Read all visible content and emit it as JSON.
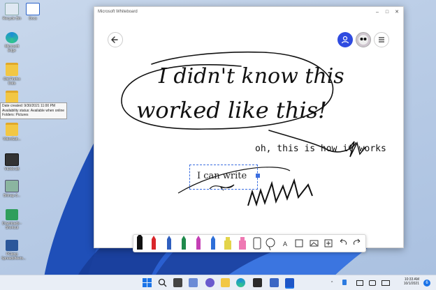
{
  "desktop": {
    "icons": [
      {
        "label": "Recycle Bin",
        "icon": "recycle-bin-icon"
      },
      {
        "label": "Docs",
        "icon": "document-icon"
      },
      {
        "label": "Microsoft Edge",
        "icon": "edge-icon"
      },
      {
        "label": "Old Firefox Data",
        "icon": "folder-icon"
      },
      {
        "label": "",
        "icon": "folder-icon"
      },
      {
        "label": "VideoSub...",
        "icon": "folder-icon"
      },
      {
        "label": "VID00.3B",
        "icon": "video-file-icon"
      },
      {
        "label": "Bitmap-3...",
        "icon": "image-file-icon"
      },
      {
        "label": "Downloads - Shortcut",
        "icon": "downloads-shortcut-icon"
      },
      {
        "label": "PCking Spreadsheets...",
        "icon": "word-file-icon"
      }
    ],
    "tooltip": {
      "line1": "Date created: 9/30/2021 11:00 PM",
      "line2": "Availability status: Available when online",
      "line3": "Folders: Pictures"
    }
  },
  "window": {
    "title": "Microsoft Whiteboard",
    "controls": {
      "minimize": "–",
      "maximize": "□",
      "close": "✕"
    }
  },
  "canvas": {
    "handwriting_1": "I didn't know this",
    "handwriting_2": "worked like this!",
    "typed_note": "oh, this is how it works",
    "text_box": "I can write"
  },
  "toolbar": {
    "pen_colors": [
      "#111111",
      "#d9262b",
      "#2f5fbf",
      "#1f8a4c",
      "#c43fb4",
      "#2e6fd8"
    ],
    "highlighter_colors": [
      "#e3d44a",
      "#ee79b3"
    ],
    "text_tool": "A"
  },
  "taskbar": {
    "time": "10:33 AM",
    "date": "10/1/2021",
    "notification_count": "6",
    "accent": "#1a73e8"
  }
}
